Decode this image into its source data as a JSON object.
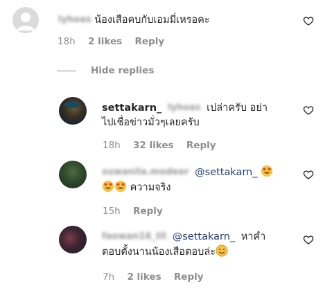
{
  "comments": [
    {
      "username": "lyhoas",
      "text": "น้องเสือคบกับเอมมี่เหรอคะ",
      "time": "18h",
      "likes": "2 likes",
      "reply": "Reply"
    }
  ],
  "hide_replies": "Hide replies",
  "replies": [
    {
      "username": "settakarn_",
      "username_suffix": "lyhoas",
      "text_line1": "เปล่าครับ อย่า",
      "text_line2": "ไปเชื่อข่าวมั่วๆเลยครับ",
      "time": "18h",
      "likes": "32 likes",
      "reply": "Reply"
    },
    {
      "username": "suwanila.modeer",
      "mention": "@settakarn_",
      "text_line2": "ความจริง",
      "time": "15h",
      "reply": "Reply"
    },
    {
      "username": "faowan16_tll",
      "mention": "@settakarn_",
      "text_line1": "หาคำ",
      "text_line2": "ตอบตั้งนานน้องเสือตอบล่ะ",
      "time": "7h",
      "likes": "2 likes",
      "reply": "Reply"
    }
  ],
  "icons": {
    "like": "heart-outline-icon",
    "heart_eyes": "heart-eyes-emoji",
    "smile": "smiling-emoji"
  },
  "colors": {
    "text": "#262626",
    "meta": "#8e8e8e",
    "mention": "#1f3b73",
    "emoji": "#f5c242",
    "heart_emoji": "#e53935"
  }
}
